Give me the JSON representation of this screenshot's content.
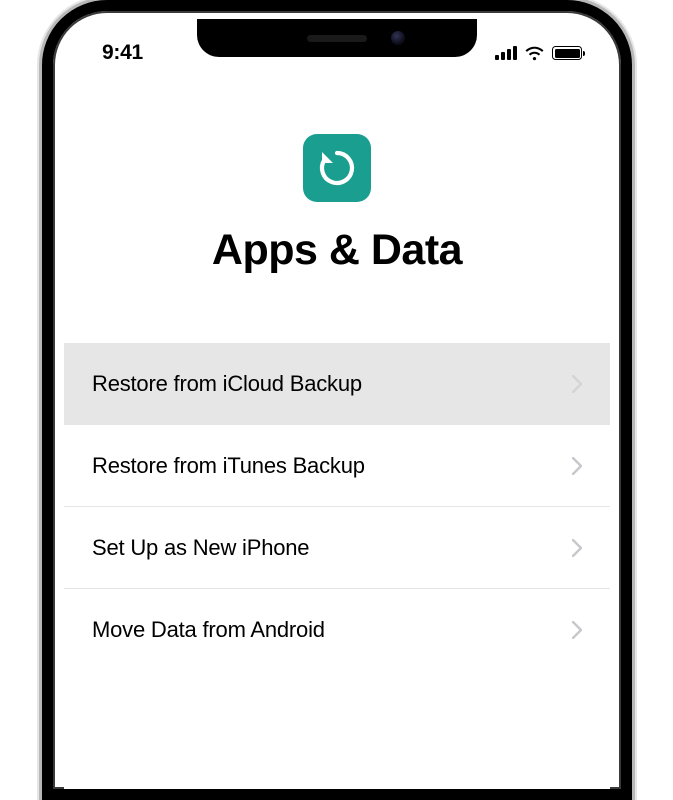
{
  "status": {
    "time": "9:41"
  },
  "header": {
    "title": "Apps & Data",
    "icon_color": "#1a9e8f"
  },
  "options": [
    {
      "label": "Restore from iCloud Backup",
      "selected": true
    },
    {
      "label": "Restore from iTunes Backup",
      "selected": false
    },
    {
      "label": "Set Up as New iPhone",
      "selected": false
    },
    {
      "label": "Move Data from Android",
      "selected": false
    }
  ]
}
